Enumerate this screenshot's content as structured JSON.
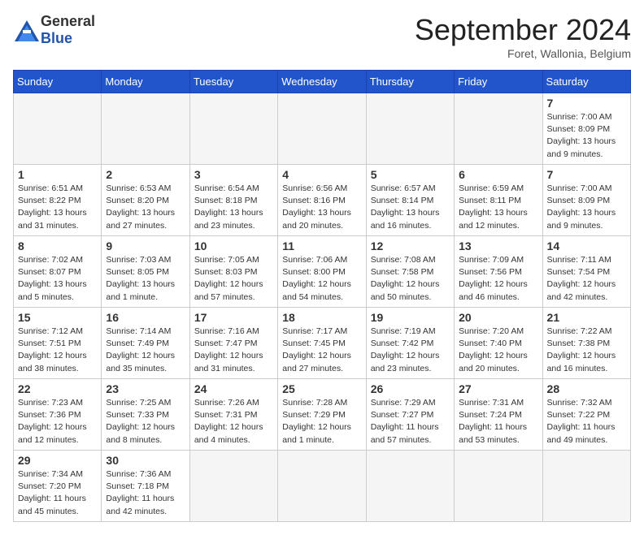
{
  "header": {
    "logo_general": "General",
    "logo_blue": "Blue",
    "title": "September 2024",
    "location": "Foret, Wallonia, Belgium"
  },
  "calendar": {
    "columns": [
      "Sunday",
      "Monday",
      "Tuesday",
      "Wednesday",
      "Thursday",
      "Friday",
      "Saturday"
    ],
    "weeks": [
      [
        null,
        null,
        null,
        null,
        null,
        null,
        {
          "day": "7",
          "rise": "Sunrise: 7:00 AM",
          "set": "Sunset: 8:09 PM",
          "day_info": "Daylight: 13 hours and 9 minutes."
        }
      ],
      [
        {
          "day": "1",
          "rise": "Sunrise: 6:51 AM",
          "set": "Sunset: 8:22 PM",
          "day_info": "Daylight: 13 hours and 31 minutes."
        },
        {
          "day": "2",
          "rise": "Sunrise: 6:53 AM",
          "set": "Sunset: 8:20 PM",
          "day_info": "Daylight: 13 hours and 27 minutes."
        },
        {
          "day": "3",
          "rise": "Sunrise: 6:54 AM",
          "set": "Sunset: 8:18 PM",
          "day_info": "Daylight: 13 hours and 23 minutes."
        },
        {
          "day": "4",
          "rise": "Sunrise: 6:56 AM",
          "set": "Sunset: 8:16 PM",
          "day_info": "Daylight: 13 hours and 20 minutes."
        },
        {
          "day": "5",
          "rise": "Sunrise: 6:57 AM",
          "set": "Sunset: 8:14 PM",
          "day_info": "Daylight: 13 hours and 16 minutes."
        },
        {
          "day": "6",
          "rise": "Sunrise: 6:59 AM",
          "set": "Sunset: 8:11 PM",
          "day_info": "Daylight: 13 hours and 12 minutes."
        },
        {
          "day": "7",
          "rise": "Sunrise: 7:00 AM",
          "set": "Sunset: 8:09 PM",
          "day_info": "Daylight: 13 hours and 9 minutes."
        }
      ],
      [
        {
          "day": "8",
          "rise": "Sunrise: 7:02 AM",
          "set": "Sunset: 8:07 PM",
          "day_info": "Daylight: 13 hours and 5 minutes."
        },
        {
          "day": "9",
          "rise": "Sunrise: 7:03 AM",
          "set": "Sunset: 8:05 PM",
          "day_info": "Daylight: 13 hours and 1 minute."
        },
        {
          "day": "10",
          "rise": "Sunrise: 7:05 AM",
          "set": "Sunset: 8:03 PM",
          "day_info": "Daylight: 12 hours and 57 minutes."
        },
        {
          "day": "11",
          "rise": "Sunrise: 7:06 AM",
          "set": "Sunset: 8:00 PM",
          "day_info": "Daylight: 12 hours and 54 minutes."
        },
        {
          "day": "12",
          "rise": "Sunrise: 7:08 AM",
          "set": "Sunset: 7:58 PM",
          "day_info": "Daylight: 12 hours and 50 minutes."
        },
        {
          "day": "13",
          "rise": "Sunrise: 7:09 AM",
          "set": "Sunset: 7:56 PM",
          "day_info": "Daylight: 12 hours and 46 minutes."
        },
        {
          "day": "14",
          "rise": "Sunrise: 7:11 AM",
          "set": "Sunset: 7:54 PM",
          "day_info": "Daylight: 12 hours and 42 minutes."
        }
      ],
      [
        {
          "day": "15",
          "rise": "Sunrise: 7:12 AM",
          "set": "Sunset: 7:51 PM",
          "day_info": "Daylight: 12 hours and 38 minutes."
        },
        {
          "day": "16",
          "rise": "Sunrise: 7:14 AM",
          "set": "Sunset: 7:49 PM",
          "day_info": "Daylight: 12 hours and 35 minutes."
        },
        {
          "day": "17",
          "rise": "Sunrise: 7:16 AM",
          "set": "Sunset: 7:47 PM",
          "day_info": "Daylight: 12 hours and 31 minutes."
        },
        {
          "day": "18",
          "rise": "Sunrise: 7:17 AM",
          "set": "Sunset: 7:45 PM",
          "day_info": "Daylight: 12 hours and 27 minutes."
        },
        {
          "day": "19",
          "rise": "Sunrise: 7:19 AM",
          "set": "Sunset: 7:42 PM",
          "day_info": "Daylight: 12 hours and 23 minutes."
        },
        {
          "day": "20",
          "rise": "Sunrise: 7:20 AM",
          "set": "Sunset: 7:40 PM",
          "day_info": "Daylight: 12 hours and 20 minutes."
        },
        {
          "day": "21",
          "rise": "Sunrise: 7:22 AM",
          "set": "Sunset: 7:38 PM",
          "day_info": "Daylight: 12 hours and 16 minutes."
        }
      ],
      [
        {
          "day": "22",
          "rise": "Sunrise: 7:23 AM",
          "set": "Sunset: 7:36 PM",
          "day_info": "Daylight: 12 hours and 12 minutes."
        },
        {
          "day": "23",
          "rise": "Sunrise: 7:25 AM",
          "set": "Sunset: 7:33 PM",
          "day_info": "Daylight: 12 hours and 8 minutes."
        },
        {
          "day": "24",
          "rise": "Sunrise: 7:26 AM",
          "set": "Sunset: 7:31 PM",
          "day_info": "Daylight: 12 hours and 4 minutes."
        },
        {
          "day": "25",
          "rise": "Sunrise: 7:28 AM",
          "set": "Sunset: 7:29 PM",
          "day_info": "Daylight: 12 hours and 1 minute."
        },
        {
          "day": "26",
          "rise": "Sunrise: 7:29 AM",
          "set": "Sunset: 7:27 PM",
          "day_info": "Daylight: 11 hours and 57 minutes."
        },
        {
          "day": "27",
          "rise": "Sunrise: 7:31 AM",
          "set": "Sunset: 7:24 PM",
          "day_info": "Daylight: 11 hours and 53 minutes."
        },
        {
          "day": "28",
          "rise": "Sunrise: 7:32 AM",
          "set": "Sunset: 7:22 PM",
          "day_info": "Daylight: 11 hours and 49 minutes."
        }
      ],
      [
        {
          "day": "29",
          "rise": "Sunrise: 7:34 AM",
          "set": "Sunset: 7:20 PM",
          "day_info": "Daylight: 11 hours and 45 minutes."
        },
        {
          "day": "30",
          "rise": "Sunrise: 7:36 AM",
          "set": "Sunset: 7:18 PM",
          "day_info": "Daylight: 11 hours and 42 minutes."
        },
        null,
        null,
        null,
        null,
        null
      ]
    ]
  }
}
